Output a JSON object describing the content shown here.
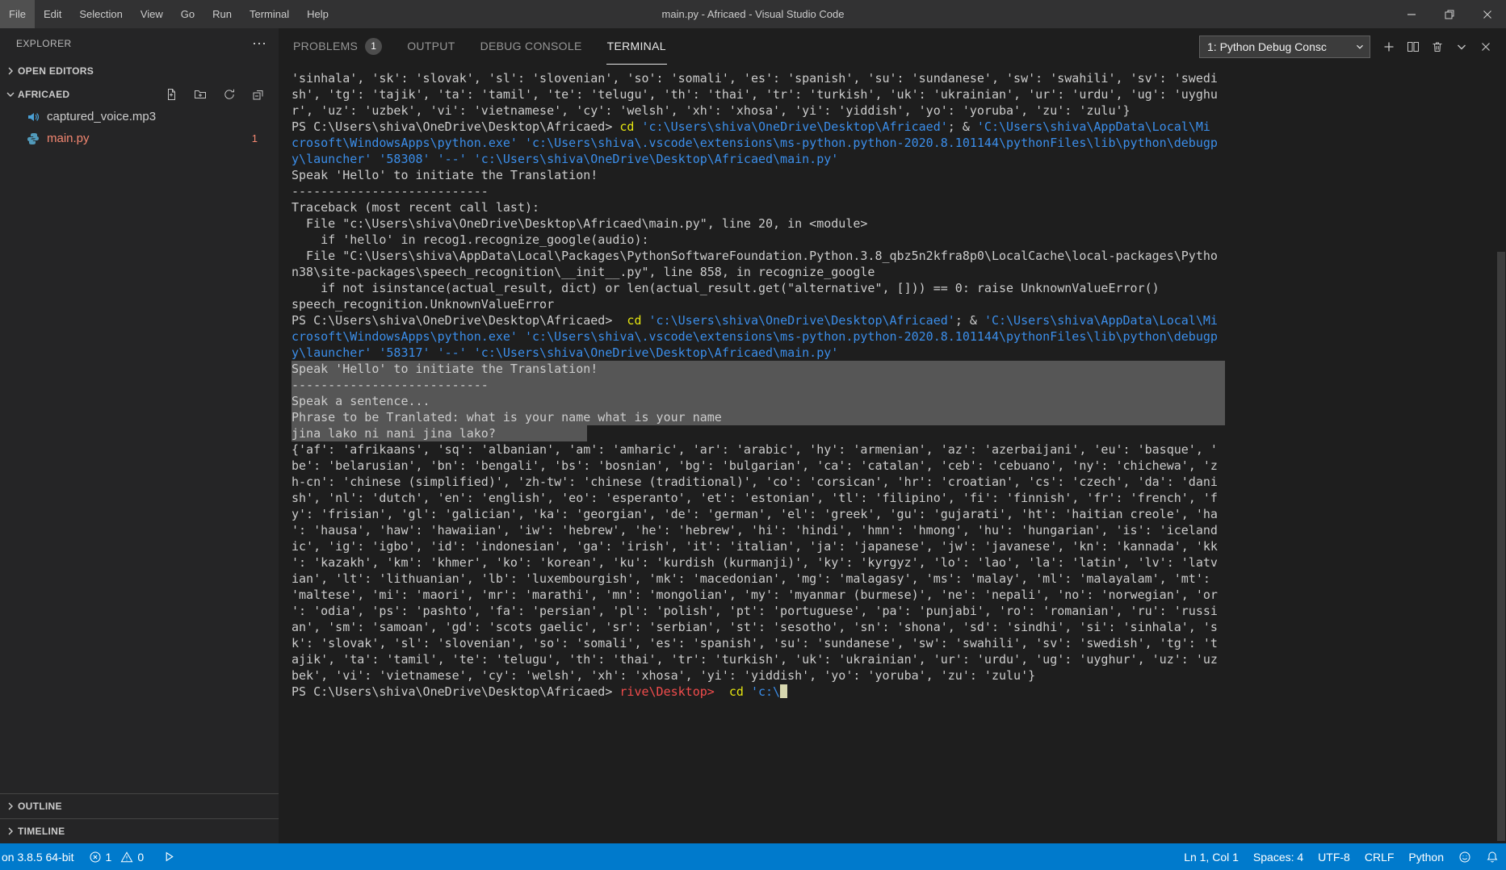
{
  "titlebar": {
    "menus": [
      "File",
      "Edit",
      "Selection",
      "View",
      "Go",
      "Run",
      "Terminal",
      "Help"
    ],
    "title": "main.py - Africaed - Visual Studio Code"
  },
  "sidebar": {
    "header": "EXPLORER",
    "more_glyph": "⋯",
    "sections": {
      "open_editors": "OPEN EDITORS",
      "folder": "AFRICAED",
      "outline": "OUTLINE",
      "timeline": "TIMELINE"
    },
    "files": [
      {
        "name": "captured_voice.mp3",
        "icon": "audio-icon"
      },
      {
        "name": "main.py",
        "icon": "python-icon",
        "error": true,
        "badge": "1"
      }
    ]
  },
  "panel": {
    "tabs": [
      {
        "label": "PROBLEMS",
        "badge": "1"
      },
      {
        "label": "OUTPUT"
      },
      {
        "label": "DEBUG CONSOLE"
      },
      {
        "label": "TERMINAL",
        "active": true
      }
    ],
    "terminal_picker": "1: Python Debug Consc"
  },
  "terminal": {
    "colors": {
      "default": "#cccccc",
      "blue": "#3b8eea",
      "yellow": "#e5e510",
      "red": "#f14c4c",
      "selection": "rgba(255,255,255,0.25)"
    },
    "lines": [
      {
        "t": "'sinhala', 'sk': 'slovak', 'sl': 'slovenian', 'so': 'somali', 'es': 'spanish', 'su': 'sundanese', 'sw': 'swahili', 'sv': 'swedi"
      },
      {
        "t": "sh', 'tg': 'tajik', 'ta': 'tamil', 'te': 'telugu', 'th': 'thai', 'tr': 'turkish', 'uk': 'ukrainian', 'ur': 'urdu', 'ug': 'uyghu"
      },
      {
        "t": "r', 'uz': 'uzbek', 'vi': 'vietnamese', 'cy': 'welsh', 'xh': 'xhosa', 'yi': 'yiddish', 'yo': 'yoruba', 'zu': 'zulu'}"
      },
      {
        "seg": [
          {
            "t": "PS C:\\Users\\shiva\\OneDrive\\Desktop\\Africaed> "
          },
          {
            "t": "cd",
            "c": "y"
          },
          {
            "t": " "
          },
          {
            "t": "'c:\\Users\\shiva\\OneDrive\\Desktop\\Africaed'",
            "c": "b"
          },
          {
            "t": "; & "
          },
          {
            "t": "'C:\\Users\\shiva\\AppData\\Local\\Mi",
            "c": "b"
          }
        ]
      },
      {
        "seg": [
          {
            "t": "crosoft\\WindowsApps\\python.exe' 'c:\\Users\\shiva\\.vscode\\extensions\\ms-python.python-2020.8.101144\\pythonFiles\\lib\\python\\debugp",
            "c": "b"
          }
        ]
      },
      {
        "seg": [
          {
            "t": "y\\launcher' '58308' '--' 'c:\\Users\\shiva\\OneDrive\\Desktop\\Africaed\\main.py'",
            "c": "b"
          }
        ]
      },
      {
        "t": "Speak 'Hello' to initiate the Translation!"
      },
      {
        "t": "---------------------------"
      },
      {
        "t": "Traceback (most recent call last):"
      },
      {
        "t": "  File \"c:\\Users\\shiva\\OneDrive\\Desktop\\Africaed\\main.py\", line 20, in <module>"
      },
      {
        "t": "    if 'hello' in recog1.recognize_google(audio):"
      },
      {
        "t": "  File \"C:\\Users\\shiva\\AppData\\Local\\Packages\\PythonSoftwareFoundation.Python.3.8_qbz5n2kfra8p0\\LocalCache\\local-packages\\Pytho"
      },
      {
        "t": "n38\\site-packages\\speech_recognition\\__init__.py\", line 858, in recognize_google"
      },
      {
        "t": "    if not isinstance(actual_result, dict) or len(actual_result.get(\"alternative\", [])) == 0: raise UnknownValueError()"
      },
      {
        "t": "speech_recognition.UnknownValueError"
      },
      {
        "seg": [
          {
            "t": "PS C:\\Users\\shiva\\OneDrive\\Desktop\\Africaed>  "
          },
          {
            "t": "cd",
            "c": "y"
          },
          {
            "t": " "
          },
          {
            "t": "'c:\\Users\\shiva\\OneDrive\\Desktop\\Africaed'",
            "c": "b"
          },
          {
            "t": "; & "
          },
          {
            "t": "'C:\\Users\\shiva\\AppData\\Local\\Mi",
            "c": "b"
          }
        ]
      },
      {
        "seg": [
          {
            "t": "crosoft\\WindowsApps\\python.exe' 'c:\\Users\\shiva\\.vscode\\extensions\\ms-python.python-2020.8.101144\\pythonFiles\\lib\\python\\debugp",
            "c": "b"
          }
        ]
      },
      {
        "seg": [
          {
            "t": "y\\launcher' '58317' '--' 'c:\\Users\\shiva\\OneDrive\\Desktop\\Africaed\\main.py'",
            "c": "b"
          }
        ]
      },
      {
        "t": "Speak 'Hello' to initiate the Translation!",
        "sel": "full"
      },
      {
        "t": "---------------------------",
        "sel": "full"
      },
      {
        "t": "Speak a sentence...",
        "sel": "full"
      },
      {
        "t": "Phrase to be Tranlated: what is your name what is your name",
        "sel": "full"
      },
      {
        "t": "jina lako ni nani jina lako?",
        "sel": "part"
      },
      {
        "t": "{'af': 'afrikaans', 'sq': 'albanian', 'am': 'amharic', 'ar': 'arabic', 'hy': 'armenian', 'az': 'azerbaijani', 'eu': 'basque', '"
      },
      {
        "t": "be': 'belarusian', 'bn': 'bengali', 'bs': 'bosnian', 'bg': 'bulgarian', 'ca': 'catalan', 'ceb': 'cebuano', 'ny': 'chichewa', 'z"
      },
      {
        "t": "h-cn': 'chinese (simplified)', 'zh-tw': 'chinese (traditional)', 'co': 'corsican', 'hr': 'croatian', 'cs': 'czech', 'da': 'dani"
      },
      {
        "t": "sh', 'nl': 'dutch', 'en': 'english', 'eo': 'esperanto', 'et': 'estonian', 'tl': 'filipino', 'fi': 'finnish', 'fr': 'french', 'f"
      },
      {
        "t": "y': 'frisian', 'gl': 'galician', 'ka': 'georgian', 'de': 'german', 'el': 'greek', 'gu': 'gujarati', 'ht': 'haitian creole', 'ha"
      },
      {
        "t": "': 'hausa', 'haw': 'hawaiian', 'iw': 'hebrew', 'he': 'hebrew', 'hi': 'hindi', 'hmn': 'hmong', 'hu': 'hungarian', 'is': 'iceland"
      },
      {
        "t": "ic', 'ig': 'igbo', 'id': 'indonesian', 'ga': 'irish', 'it': 'italian', 'ja': 'japanese', 'jw': 'javanese', 'kn': 'kannada', 'kk"
      },
      {
        "t": "': 'kazakh', 'km': 'khmer', 'ko': 'korean', 'ku': 'kurdish (kurmanji)', 'ky': 'kyrgyz', 'lo': 'lao', 'la': 'latin', 'lv': 'latv"
      },
      {
        "t": "ian', 'lt': 'lithuanian', 'lb': 'luxembourgish', 'mk': 'macedonian', 'mg': 'malagasy', 'ms': 'malay', 'ml': 'malayalam', 'mt':"
      },
      {
        "t": "'maltese', 'mi': 'maori', 'mr': 'marathi', 'mn': 'mongolian', 'my': 'myanmar (burmese)', 'ne': 'nepali', 'no': 'norwegian', 'or"
      },
      {
        "t": "': 'odia', 'ps': 'pashto', 'fa': 'persian', 'pl': 'polish', 'pt': 'portuguese', 'pa': 'punjabi', 'ro': 'romanian', 'ru': 'russi"
      },
      {
        "t": "an', 'sm': 'samoan', 'gd': 'scots gaelic', 'sr': 'serbian', 'st': 'sesotho', 'sn': 'shona', 'sd': 'sindhi', 'si': 'sinhala', 's"
      },
      {
        "t": "k': 'slovak', 'sl': 'slovenian', 'so': 'somali', 'es': 'spanish', 'su': 'sundanese', 'sw': 'swahili', 'sv': 'swedish', 'tg': 't"
      },
      {
        "t": "ajik', 'ta': 'tamil', 'te': 'telugu', 'th': 'thai', 'tr': 'turkish', 'uk': 'ukrainian', 'ur': 'urdu', 'ug': 'uyghur', 'uz': 'uz"
      },
      {
        "t": "bek', 'vi': 'vietnamese', 'cy': 'welsh', 'xh': 'xhosa', 'yi': 'yiddish', 'yo': 'yoruba', 'zu': 'zulu'}"
      },
      {
        "seg": [
          {
            "t": "PS C:\\Users\\shiva\\OneDrive\\Desktop\\Africaed> "
          },
          {
            "t": "rive\\Desktop>",
            "c": "r"
          },
          {
            "t": "  "
          },
          {
            "t": "cd",
            "c": "y"
          },
          {
            "t": " "
          },
          {
            "t": "'c:\\",
            "c": "b"
          }
        ],
        "cursor": true
      }
    ]
  },
  "statusbar": {
    "interpreter": "on 3.8.5 64-bit",
    "errors": "1",
    "warnings": "0",
    "cursor_position": "Ln 1, Col 1",
    "indentation": "Spaces: 4",
    "encoding": "UTF-8",
    "eol": "CRLF",
    "language": "Python"
  }
}
